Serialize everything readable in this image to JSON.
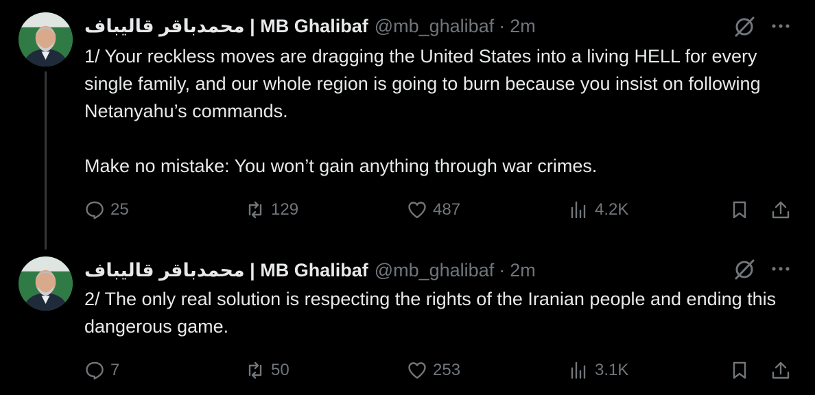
{
  "tweets": [
    {
      "author_name": "محمدباقر قالیباف | MB Ghalibaf",
      "handle": "@mb_ghalibaf",
      "separator": "·",
      "time": "2m",
      "paragraphs": [
        "1/ Your reckless moves are dragging the United States into a living HELL for every single family, and our whole region is going to burn because you insist on following Netanyahu’s commands.",
        "Make no mistake: You won’t gain anything through war crimes."
      ],
      "stats": {
        "replies": "25",
        "reposts": "129",
        "likes": "487",
        "views": "4.2K"
      }
    },
    {
      "author_name": "محمدباقر قالیباف | MB Ghalibaf",
      "handle": "@mb_ghalibaf",
      "separator": "·",
      "time": "2m",
      "paragraphs": [
        "2/ The only real solution is respecting the rights of the Iranian people and ending this dangerous game."
      ],
      "stats": {
        "replies": "7",
        "reposts": "50",
        "likes": "253",
        "views": "3.1K"
      }
    }
  ],
  "icons": [
    "avatar",
    "grok-icon",
    "more-icon",
    "reply-icon",
    "repost-icon",
    "like-icon",
    "views-icon",
    "bookmark-icon",
    "share-icon"
  ],
  "colors": {
    "background": "#000000",
    "text": "#e7e9ea",
    "muted": "#71767b",
    "thread_line": "#333639"
  }
}
